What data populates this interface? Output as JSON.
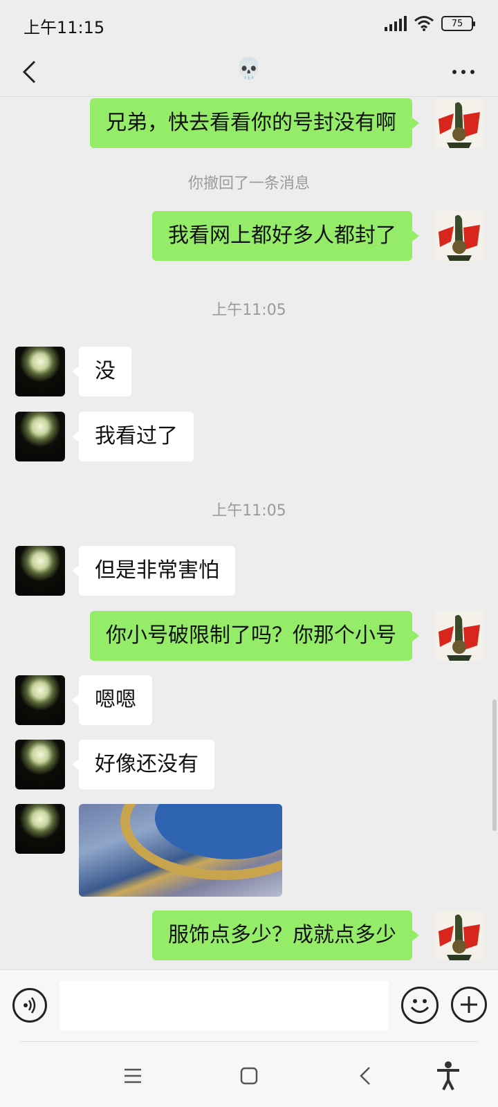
{
  "status_bar": {
    "time": "上午11:15",
    "battery": "75"
  },
  "header": {
    "title": "💀"
  },
  "messages": {
    "m1": "兄弟，快去看看你的号封没有啊",
    "recall": "你撤回了一条消息",
    "m2": "我看网上都好多人都封了",
    "ts1": "上午11:05",
    "m3": "没",
    "m4": "我看过了",
    "ts2": "上午11:05",
    "m5": "但是非常害怕",
    "m6": "你小号破限制了吗？你那个小号",
    "m7": "嗯嗯",
    "m8": "好像还没有",
    "m9": "服饰点多少？成就点多少"
  },
  "input": {
    "value": ""
  },
  "colors": {
    "me_bubble": "#95ec69",
    "other_bubble": "#ffffff",
    "background": "#ededed"
  },
  "icons": {
    "back": "chevron-left-icon",
    "more": "more-dots-icon",
    "voice": "voice-icon",
    "emoji": "emoji-icon",
    "plus": "plus-icon",
    "menu": "menu-icon",
    "home": "home-icon",
    "sys_back": "back-icon",
    "accessibility": "accessibility-icon"
  }
}
